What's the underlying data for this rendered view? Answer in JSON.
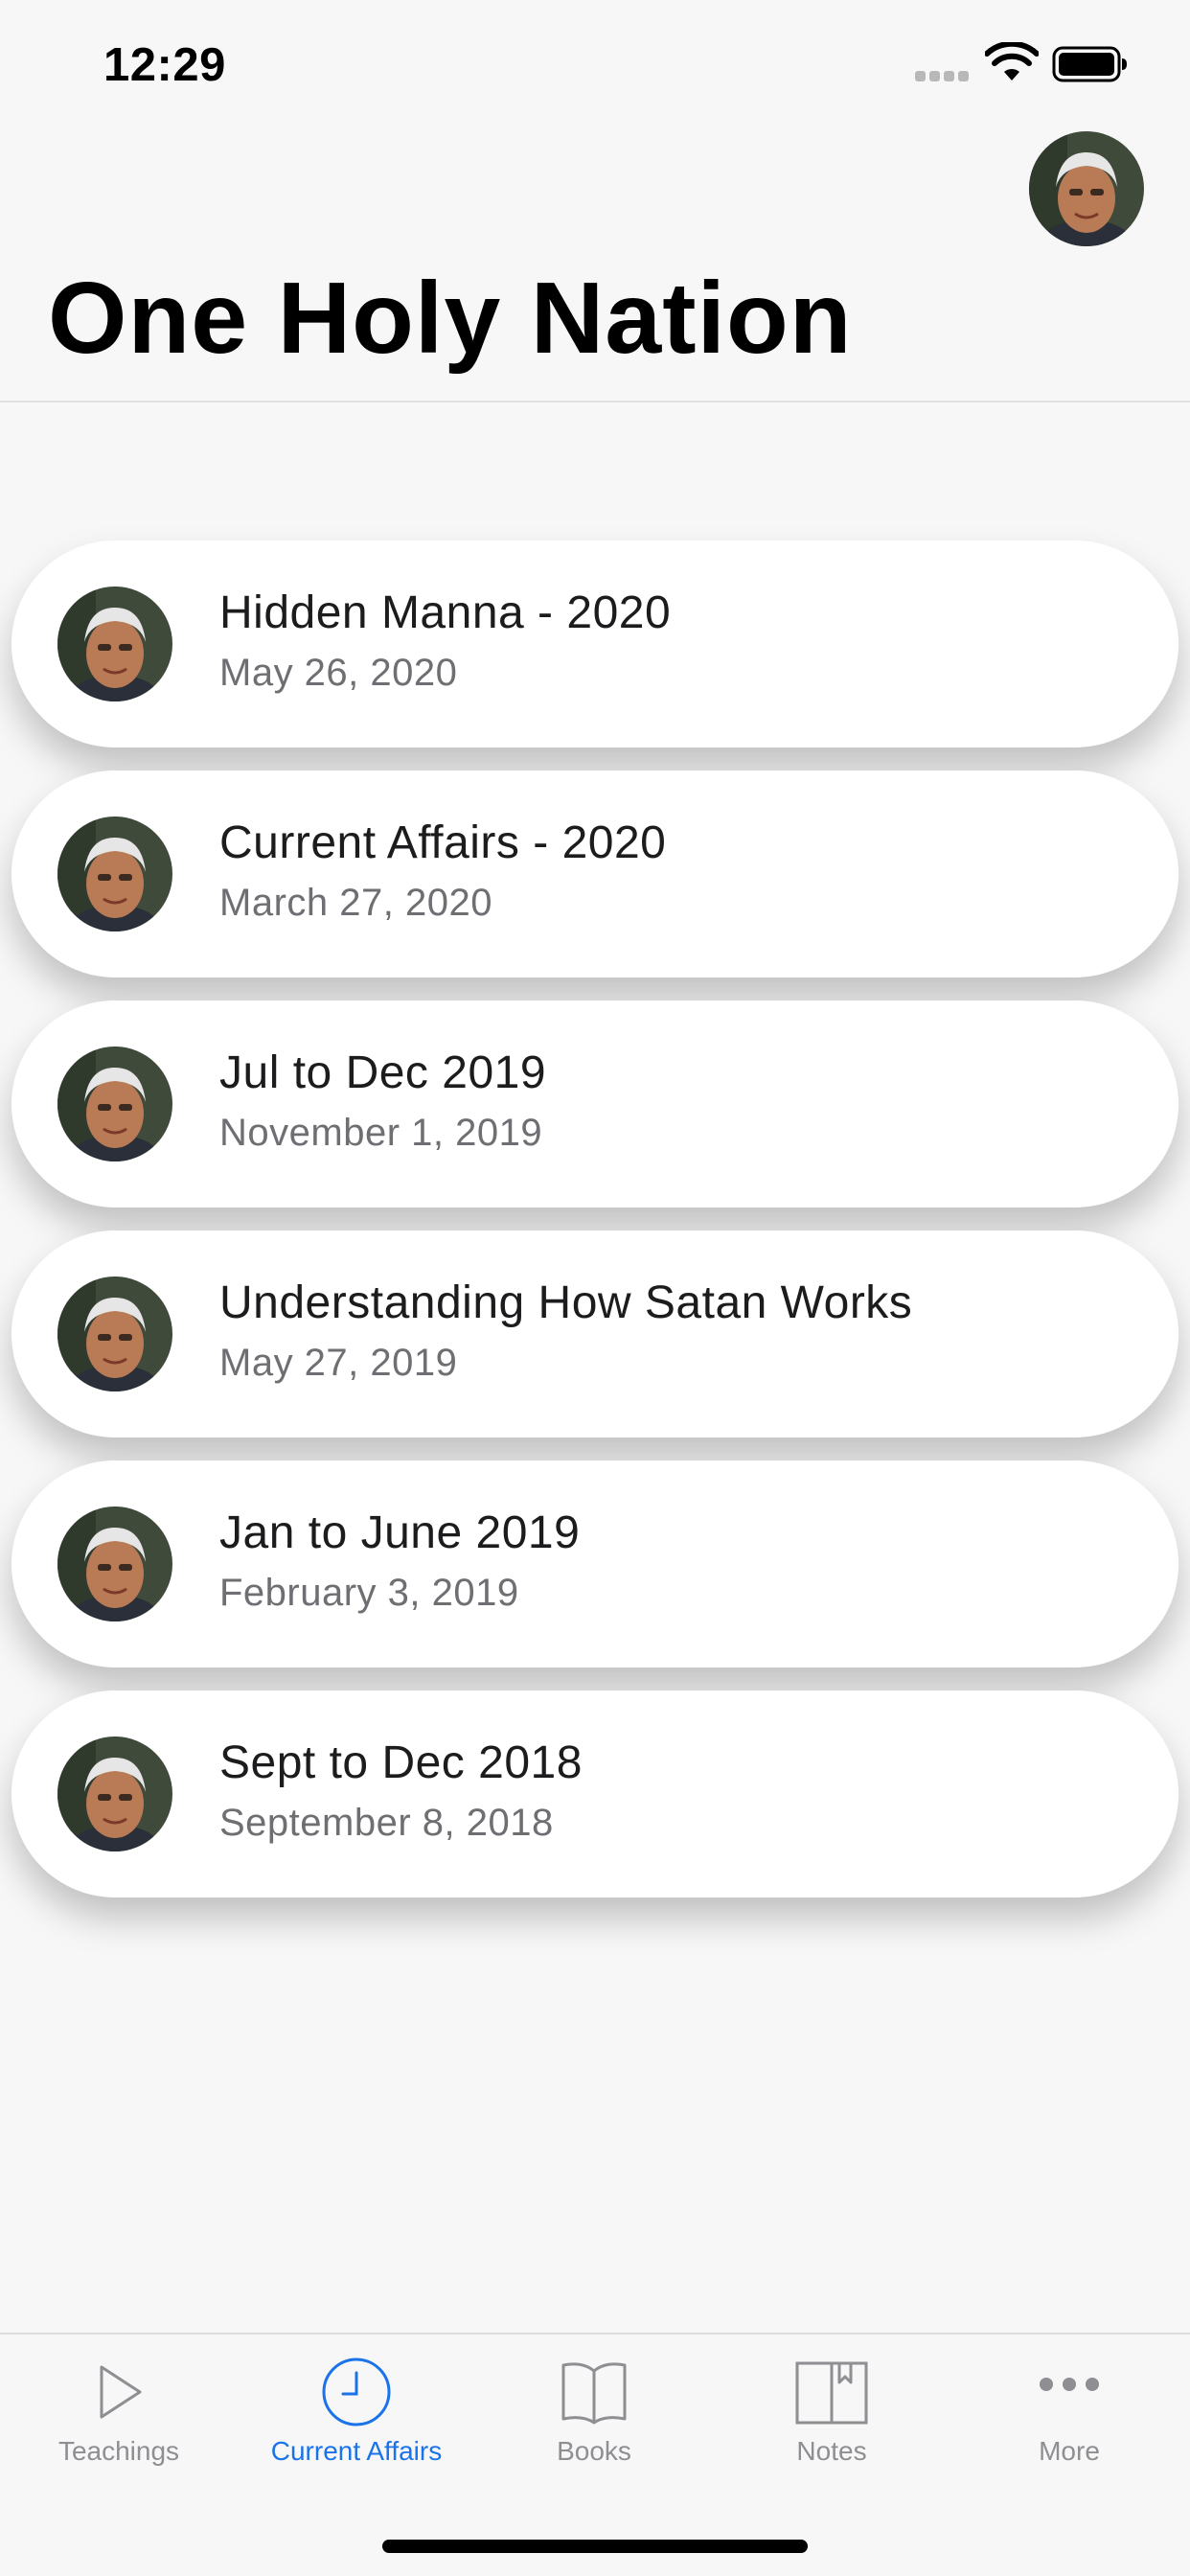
{
  "status_bar": {
    "time": "12:29"
  },
  "header": {
    "title": "One Holy Nation",
    "avatar_icon": "profile-avatar"
  },
  "items": [
    {
      "title": "Hidden Manna - 2020",
      "date": "May 26, 2020"
    },
    {
      "title": "Current Affairs - 2020",
      "date": "March 27, 2020"
    },
    {
      "title": "Jul to Dec 2019",
      "date": "November 1, 2019"
    },
    {
      "title": "Understanding How Satan Works",
      "date": "May 27, 2019"
    },
    {
      "title": "Jan to June 2019",
      "date": "February 3, 2019"
    },
    {
      "title": "Sept to Dec 2018",
      "date": "September 8, 2018"
    }
  ],
  "tab_bar": {
    "tabs": [
      {
        "label": "Teachings",
        "icon": "play-icon"
      },
      {
        "label": "Current Affairs",
        "icon": "clock-icon",
        "active": true
      },
      {
        "label": "Books",
        "icon": "book-icon"
      },
      {
        "label": "Notes",
        "icon": "notebook-icon"
      },
      {
        "label": "More",
        "icon": "more-icon"
      }
    ]
  },
  "colors": {
    "accent": "#1a73e8",
    "inactive": "#8e8e93",
    "background": "#f7f7f7",
    "card": "#ffffff"
  }
}
